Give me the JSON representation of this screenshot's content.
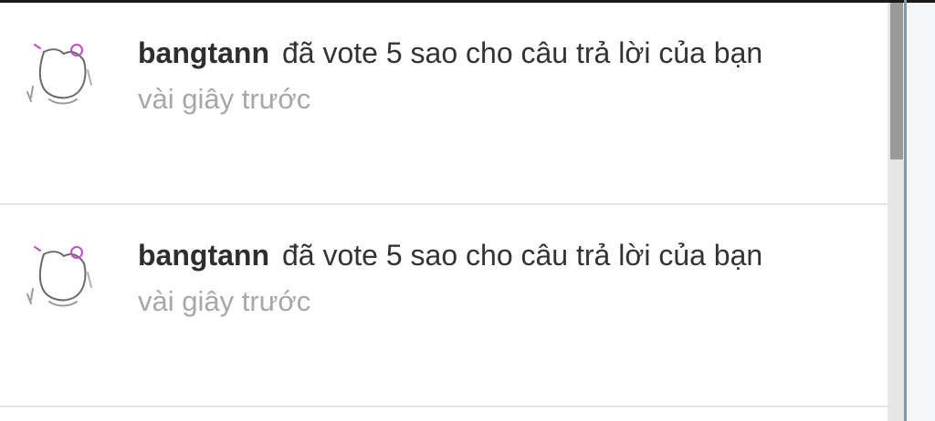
{
  "notifications": [
    {
      "username": "bangtann",
      "message": "đã vote 5 sao cho câu trả lời của bạn",
      "time": "vài giây trước",
      "avatar_icon": "cat-doodle-avatar"
    },
    {
      "username": "bangtann",
      "message": "đã vote 5 sao cho câu trả lời của bạn",
      "time": "vài giây trước",
      "avatar_icon": "cat-doodle-avatar"
    }
  ],
  "colors": {
    "username": "#2e2e2e",
    "message": "#333333",
    "time": "#a7a7a7",
    "divider": "#e3e3e3",
    "scroll_thumb": "#9a9a9a",
    "avatar_accent": "#c04fc6"
  }
}
